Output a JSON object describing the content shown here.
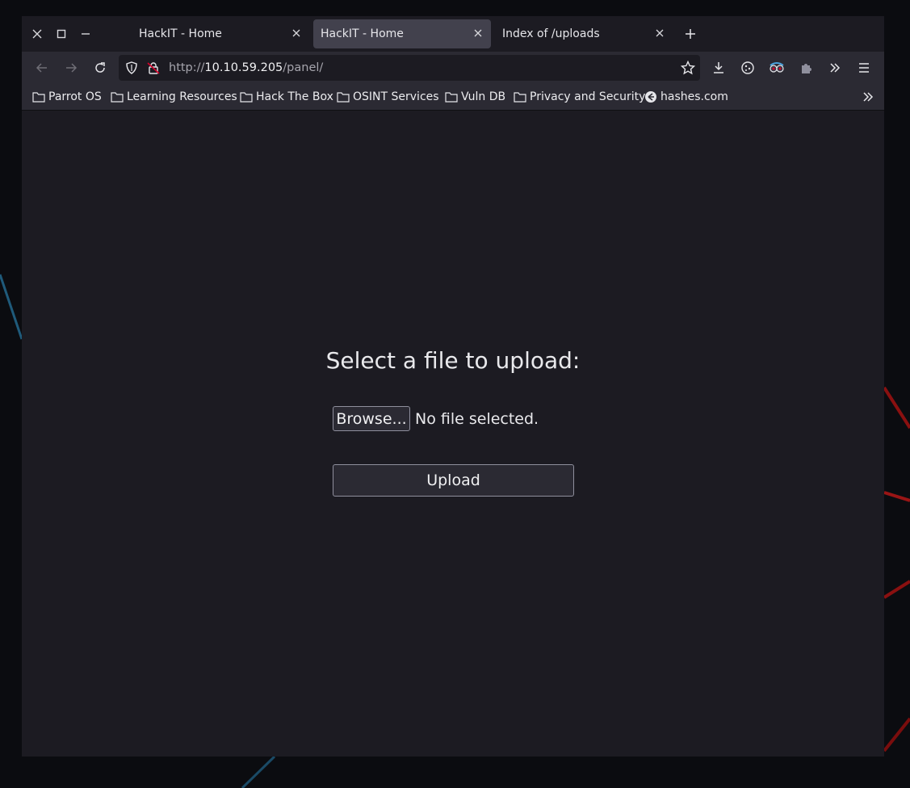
{
  "window_controls": {
    "close": "close-icon",
    "maximize": "maximize-icon",
    "minimize": "minimize-icon"
  },
  "tabs": [
    {
      "title": "HackIT - Home",
      "active": false
    },
    {
      "title": "HackIT - Home",
      "active": true
    },
    {
      "title": "Index of /uploads",
      "active": false
    }
  ],
  "url": {
    "prefix": "http://",
    "host": "10.10.59.205",
    "path": "/panel/"
  },
  "bookmarks": [
    {
      "label": "Parrot OS",
      "icon": "folder-icon"
    },
    {
      "label": "Learning Resources",
      "icon": "folder-icon"
    },
    {
      "label": "Hack The Box",
      "icon": "folder-icon"
    },
    {
      "label": "OSINT Services",
      "icon": "folder-icon"
    },
    {
      "label": "Vuln DB",
      "icon": "folder-icon"
    },
    {
      "label": "Privacy and Security",
      "icon": "folder-icon"
    },
    {
      "label": "hashes.com",
      "icon": "site-icon"
    }
  ],
  "page": {
    "heading": "Select a file to upload:",
    "browse_label": "Browse...",
    "file_status": "No file selected.",
    "upload_label": "Upload"
  },
  "colors": {
    "accent_red": "#d7002a",
    "toolbar": "#2b2a33",
    "content_bg": "#1c1b22"
  }
}
